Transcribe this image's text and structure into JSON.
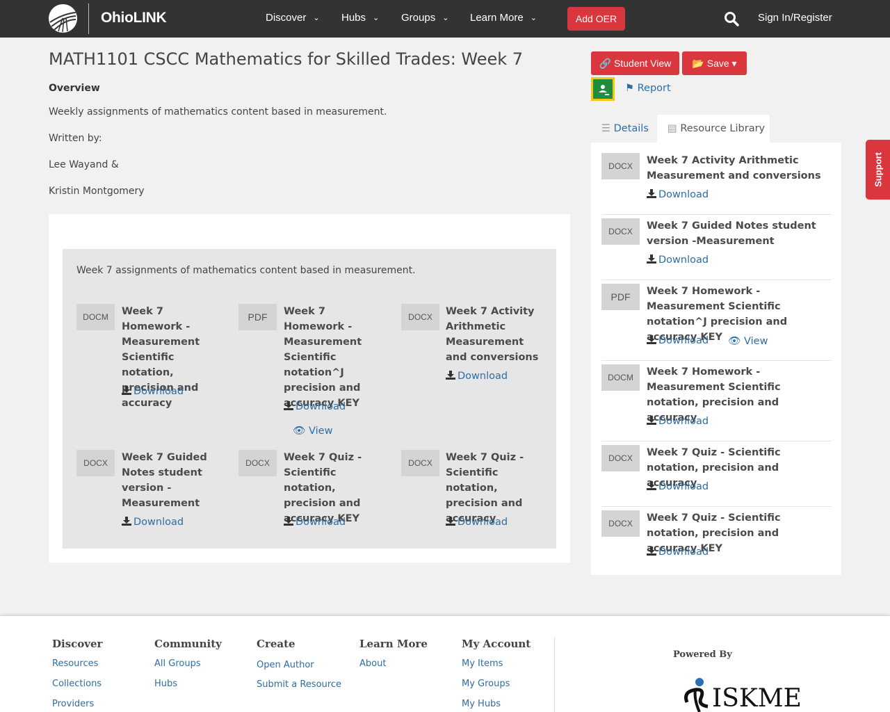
{
  "header": {
    "brand": "OhioLINK",
    "nav": [
      {
        "label": "Discover"
      },
      {
        "label": "Hubs"
      },
      {
        "label": "Groups"
      },
      {
        "label": "Learn More"
      }
    ],
    "add_oer": "Add OER",
    "signin": "Sign In/Register"
  },
  "page": {
    "title": "MATH1101 CSCC Mathematics for Skilled Trades: Week 7",
    "overview_heading": "Overview",
    "overview_text": "Weekly assignments of mathematics content based in measurement.",
    "written_by": "Written by:",
    "author1": "Lee Wayand &",
    "author2": "Kristin Montgomery",
    "grey_intro": "Week 7 assignments of mathematics content based in measurement."
  },
  "grid": [
    {
      "ext": "DOCM",
      "title": "Week 7 Homework - Measurement Scientific notation, precision and accuracy",
      "download": "Download"
    },
    {
      "ext": "PDF",
      "title": "Week 7 Homework - Measurement Scientific notation^J precision and accuracy KEY",
      "download": "Download",
      "view": "View"
    },
    {
      "ext": "DOCX",
      "title": "Week 7 Activity Arithmetic Measurement and conversions",
      "download": "Download"
    },
    {
      "ext": "DOCX",
      "title": "Week 7 Guided Notes student version - Measurement",
      "download": "Download"
    },
    {
      "ext": "DOCX",
      "title": "Week 7 Quiz - Scientific notation, precision and accuracy KEY",
      "download": "Download"
    },
    {
      "ext": "DOCX",
      "title": "Week 7 Quiz - Scientific notation, precision and accuracy",
      "download": "Download"
    }
  ],
  "sidebar": {
    "student_view": "Student View",
    "save": "Save",
    "report": "Report",
    "tab_details": "Details",
    "tab_library": "Resource Library",
    "items": [
      {
        "ext": "DOCX",
        "title": "Week 7 Activity Arithmetic Measurement and conversions",
        "download": "Download"
      },
      {
        "ext": "DOCX",
        "title": "Week 7 Guided Notes student version -Measurement",
        "download": "Download"
      },
      {
        "ext": "PDF",
        "title": "Week 7 Homework - Measurement Scientific notation^J precision and accuracy KEY",
        "download": "Download",
        "view": "View"
      },
      {
        "ext": "DOCM",
        "title": "Week 7 Homework - Measurement Scientific notation, precision and accuracy",
        "download": "Download"
      },
      {
        "ext": "DOCX",
        "title": "Week 7 Quiz - Scientific notation, precision and accuracy",
        "download": "Download"
      },
      {
        "ext": "DOCX",
        "title": "Week 7 Quiz - Scientific notation, precision and accuracy KEY",
        "download": "Download"
      }
    ]
  },
  "support": "Support",
  "footer": {
    "columns": [
      {
        "heading": "Discover",
        "links": [
          "Resources",
          "Collections",
          "Providers"
        ]
      },
      {
        "heading": "Community",
        "links": [
          "All Groups",
          "Hubs"
        ]
      },
      {
        "heading": "Create",
        "links": [
          "Open Author",
          "Submit a Resource"
        ]
      },
      {
        "heading": "Learn More",
        "links": [
          "About"
        ]
      },
      {
        "heading": "My Account",
        "links": [
          "My Items",
          "My Groups",
          "My Hubs"
        ]
      }
    ],
    "powered_by": "Powered By",
    "iskme_logo": "ISKME"
  },
  "colors": {
    "accent": "#d9363e",
    "link": "#2e6da4",
    "header_bg": "#333333"
  }
}
